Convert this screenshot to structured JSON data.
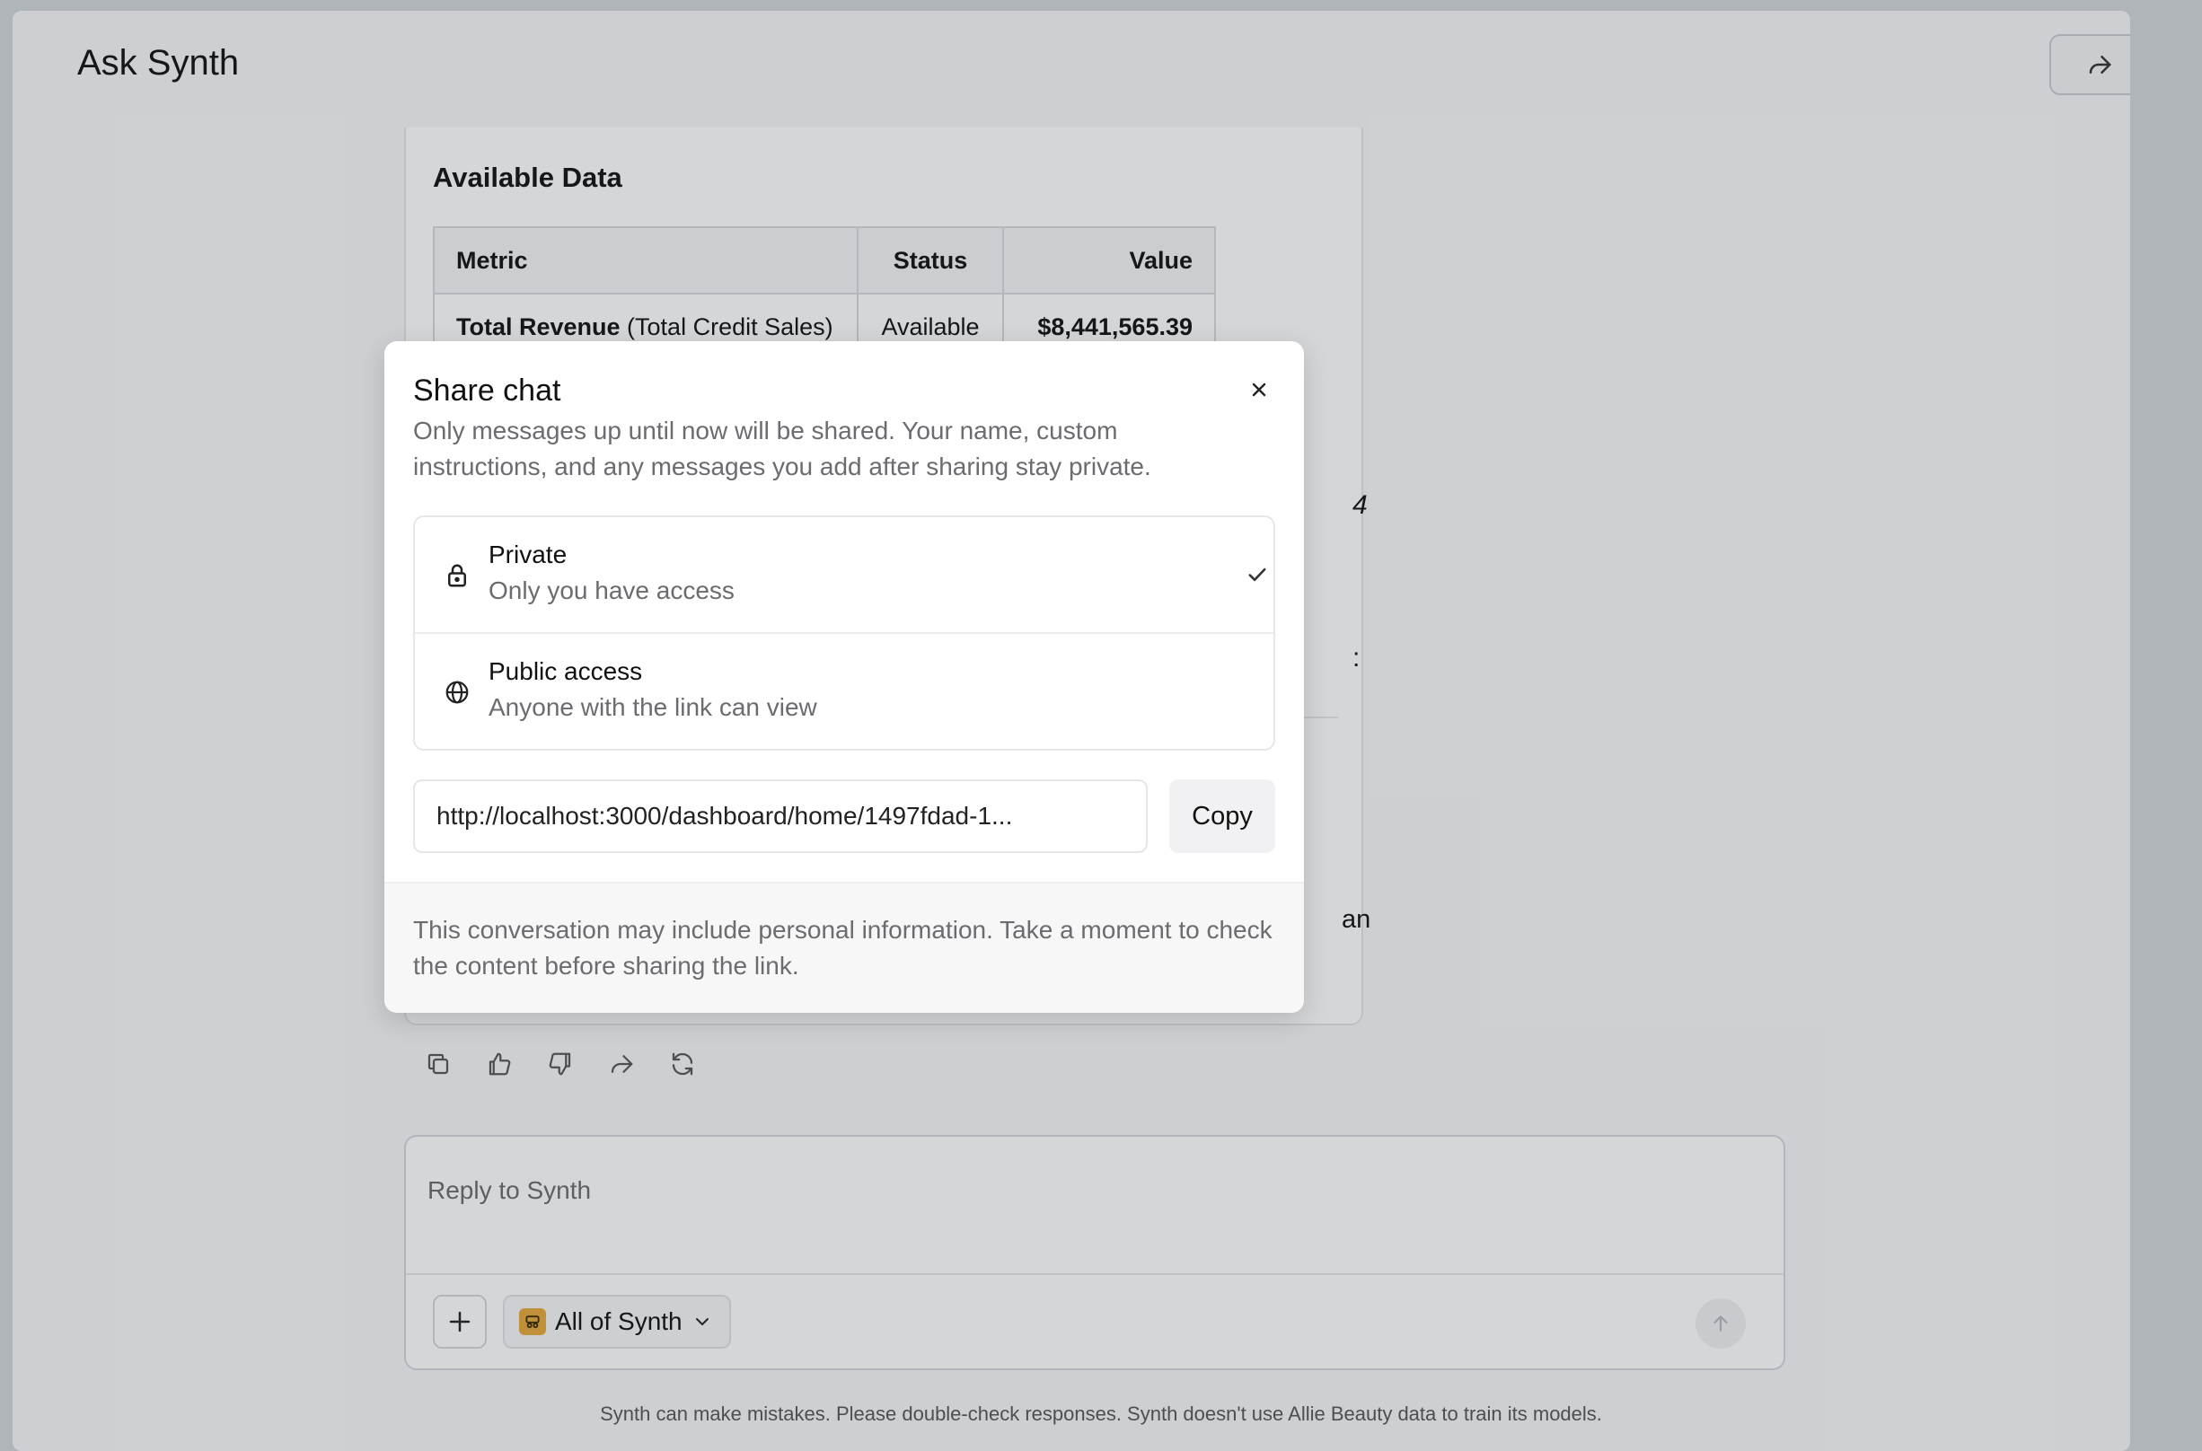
{
  "header": {
    "title": "Ask Synth",
    "share_icon": "share-arrow-icon"
  },
  "message": {
    "section_title": "Available Data",
    "table": {
      "columns": [
        "Metric",
        "Status",
        "Value"
      ],
      "rows": [
        {
          "metric_bold": "Total Revenue",
          "metric_rest": " (Total Credit Sales)",
          "status": "Available",
          "value": "$8,441,565.39"
        }
      ]
    },
    "obscured_fragments": [
      "4",
      ":",
      "an"
    ],
    "actions": [
      "copy-icon",
      "thumbs-up-icon",
      "thumbs-down-icon",
      "share-icon",
      "regenerate-icon"
    ]
  },
  "composer": {
    "placeholder": "Reply to Synth",
    "scope_label": "All of Synth"
  },
  "disclaimer": "Synth can make mistakes. Please double-check responses. Synth doesn't use Allie Beauty data to train its models.",
  "share_modal": {
    "title": "Share chat",
    "description": "Only messages up until now will be shared. Your name, custom instructions, and any messages you add after sharing stay private.",
    "options": [
      {
        "label": "Private",
        "sublabel": "Only you have access",
        "icon": "lock-icon",
        "selected": true
      },
      {
        "label": "Public access",
        "sublabel": "Anyone with the link can view",
        "icon": "globe-icon",
        "selected": false
      }
    ],
    "link": "http://localhost:3000/dashboard/home/1497fdad-1...",
    "copy_label": "Copy",
    "footer_note": "This conversation may include personal information. Take a moment to check the content before sharing the link."
  }
}
